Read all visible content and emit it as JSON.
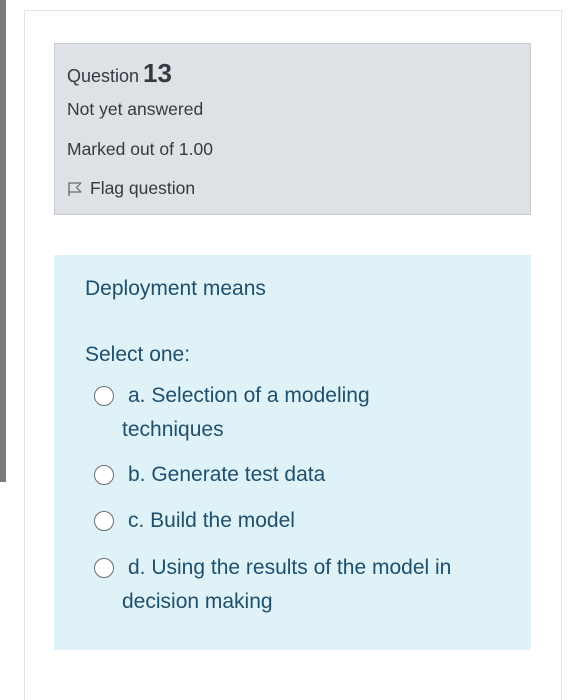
{
  "question": {
    "label": "Question",
    "number": "13",
    "state": "Not yet answered",
    "grade": "Marked out of 1.00",
    "flag_label": "Flag question"
  },
  "content": {
    "qtext": "Deployment means",
    "prompt": "Select one:",
    "options": [
      {
        "line1": "a. Selection of a modeling",
        "line2": "techniques"
      },
      {
        "line1": "b. Generate test data",
        "line2": ""
      },
      {
        "line1": "c. Build the model",
        "line2": ""
      },
      {
        "line1": "d. Using the results of the model in",
        "line2": "decision making"
      }
    ]
  },
  "icons": {
    "flag": "flag-outline-icon",
    "radio": "radio-unchecked-icon"
  },
  "colors": {
    "info_bg": "#dee2e6",
    "content_bg": "#def2f8",
    "question_text": "#1e4f6d"
  }
}
